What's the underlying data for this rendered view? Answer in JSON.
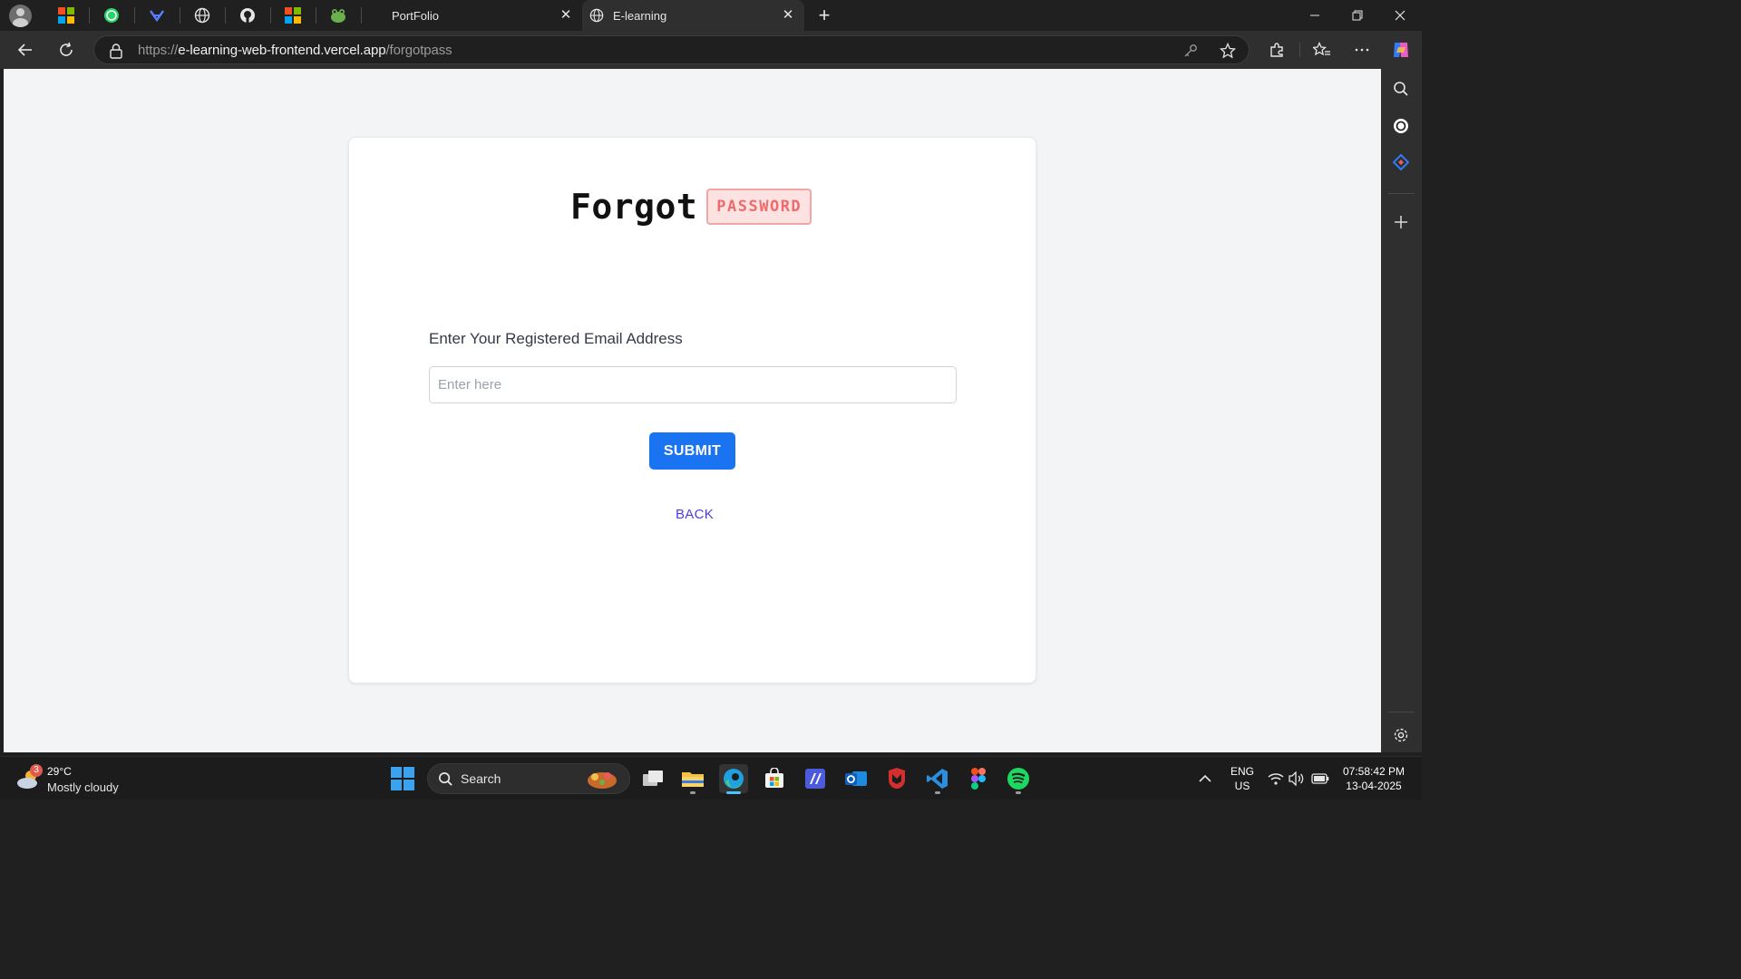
{
  "browser": {
    "tabs": [
      {
        "title": "PortFolio",
        "active": false
      },
      {
        "title": "E-learning",
        "active": true
      }
    ],
    "url": {
      "prefix": "https://",
      "host": "e-learning-web-frontend.vercel.app",
      "path": "/forgotpass"
    }
  },
  "page": {
    "heading_main": "Forgot",
    "heading_badge": "PASSWORD",
    "field_label": "Enter Your Registered Email Address",
    "email_placeholder": "Enter here",
    "email_value": "",
    "submit_label": "SUBMIT",
    "back_label": "BACK"
  },
  "taskbar": {
    "weather": {
      "temp": "29°C",
      "condition": "Mostly cloudy",
      "badge": "3"
    },
    "search_label": "Search",
    "lang_line1": "ENG",
    "lang_line2": "US",
    "time": "07:58:42 PM",
    "date": "13-04-2025"
  },
  "colors": {
    "accent_blue": "#1a73f0",
    "badge_red": "#ef6b6b",
    "badge_bg": "#fde2e2",
    "link_purple": "#5040d6",
    "page_bg": "#f3f4f6"
  },
  "icons": [
    "profile-avatar-icon",
    "windows-store-icon",
    "whatsapp-icon",
    "globe-icon",
    "github-icon",
    "back-arrow-icon",
    "refresh-icon",
    "lock-icon",
    "key-icon",
    "star-icon",
    "extensions-icon",
    "favorites-icon",
    "more-icon",
    "copilot-icon",
    "search-icon",
    "settings-icon",
    "windows-start-icon",
    "wifi-icon",
    "volume-icon",
    "battery-icon"
  ]
}
